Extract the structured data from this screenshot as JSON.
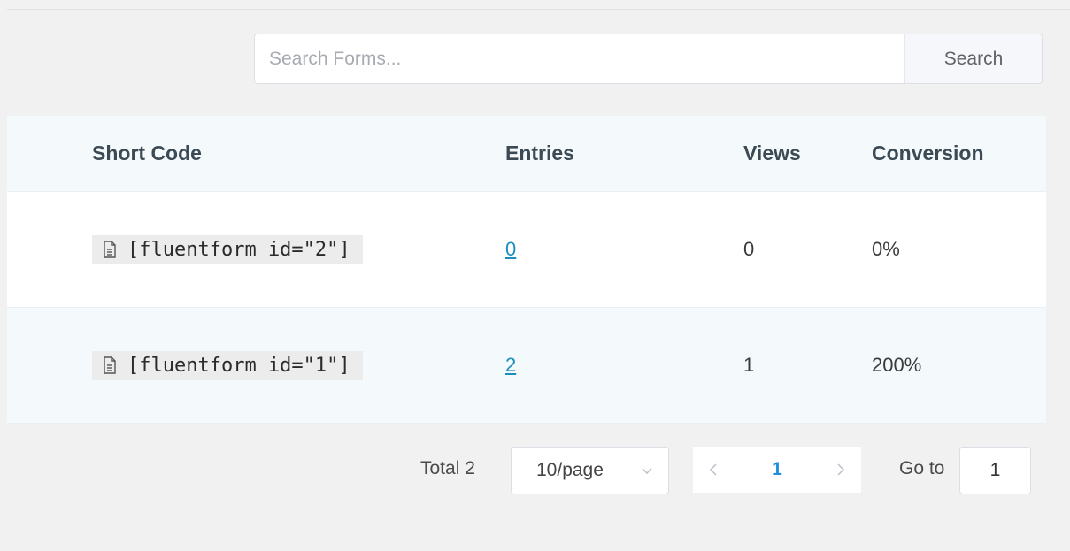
{
  "search": {
    "placeholder": "Search Forms...",
    "button_label": "Search"
  },
  "table": {
    "headers": {
      "short_code": "Short Code",
      "entries": "Entries",
      "views": "Views",
      "conversion": "Conversion"
    },
    "rows": [
      {
        "short_code": "[fluentform id=\"2\"]",
        "entries": "0",
        "views": "0",
        "conversion": "0%"
      },
      {
        "short_code": "[fluentform id=\"1\"]",
        "entries": "2",
        "views": "1",
        "conversion": "200%"
      }
    ],
    "shortcode_icon": "document-icon"
  },
  "pagination": {
    "total_label": "Total 2",
    "page_size": "10/page",
    "current_page": "1",
    "goto_label": "Go to",
    "goto_value": "1"
  },
  "colors": {
    "link": "#1a8fbf",
    "active_page": "#1f8fe0",
    "header_bg": "#f4f9fb"
  }
}
